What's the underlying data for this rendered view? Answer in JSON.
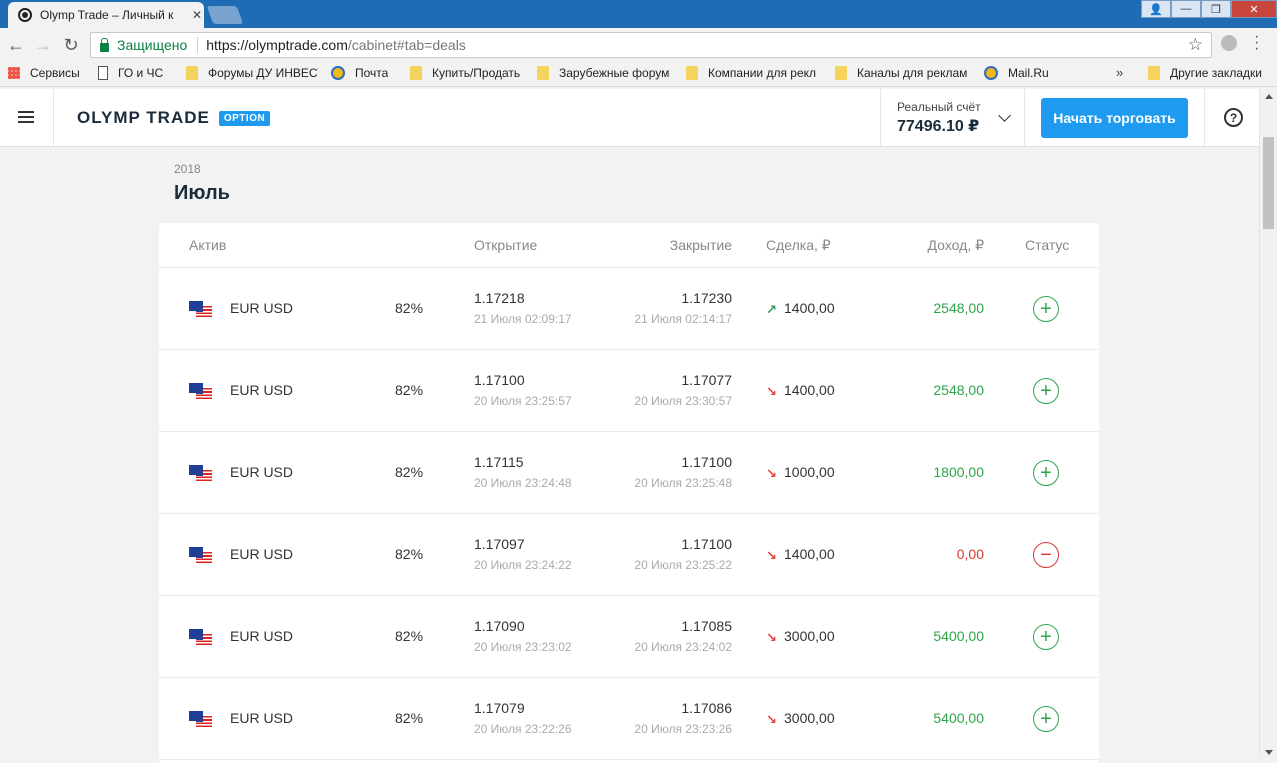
{
  "browser": {
    "tab_title": "Olymp Trade – Личный к",
    "tab_close": "✕",
    "window_buttons": [
      "👤",
      "—",
      "❐",
      "✕"
    ],
    "secure_label": "Защищено",
    "url_main": "https://olymptrade.com",
    "url_rest": "/cabinet#tab=deals",
    "bookmarks": [
      {
        "label": "Сервисы",
        "icon": "apps-icon"
      },
      {
        "label": "ГО и ЧС",
        "icon": "page-icon"
      },
      {
        "label": "Форумы ДУ ИНВЕСТ",
        "icon": "folder-icon"
      },
      {
        "label": "Почта",
        "icon": "mail-icon"
      },
      {
        "label": "Купить/Продать",
        "icon": "folder-icon"
      },
      {
        "label": "Зарубежные форум",
        "icon": "folder-icon"
      },
      {
        "label": "Компании для рекл",
        "icon": "folder-icon"
      },
      {
        "label": "Каналы для реклам",
        "icon": "folder-icon"
      },
      {
        "label": "Mail.Ru",
        "icon": "mail-icon"
      }
    ],
    "bookmarks_more": "»",
    "other_bookmarks": "Другие закладки"
  },
  "header": {
    "logo_text": "OLYMP TRADE",
    "logo_badge": "OPTION",
    "account_label": "Реальный счёт",
    "account_balance": "77496.10 ₽",
    "trade_button": "Начать торговать",
    "help": "?"
  },
  "deals": {
    "year": "2018",
    "month": "Июль",
    "columns": {
      "asset": "Актив",
      "open": "Открытие",
      "close": "Закрытие",
      "deal": "Сделка, ₽",
      "income": "Доход, ₽",
      "status": "Статус"
    },
    "rows": [
      {
        "asset": "EUR USD",
        "payout": "82%",
        "open_price": "1.17218",
        "open_time": "21 Июля 02:09:17",
        "close_price": "1.17230",
        "close_time": "21 Июля 02:14:17",
        "direction": "up",
        "arrow": "↗",
        "amount": "1400,00",
        "income": "2548,00",
        "result": "win",
        "status_symbol": "+"
      },
      {
        "asset": "EUR USD",
        "payout": "82%",
        "open_price": "1.17100",
        "open_time": "20 Июля 23:25:57",
        "close_price": "1.17077",
        "close_time": "20 Июля 23:30:57",
        "direction": "down",
        "arrow": "↘",
        "amount": "1400,00",
        "income": "2548,00",
        "result": "win",
        "status_symbol": "+"
      },
      {
        "asset": "EUR USD",
        "payout": "82%",
        "open_price": "1.17115",
        "open_time": "20 Июля 23:24:48",
        "close_price": "1.17100",
        "close_time": "20 Июля 23:25:48",
        "direction": "down",
        "arrow": "↘",
        "amount": "1000,00",
        "income": "1800,00",
        "result": "win",
        "status_symbol": "+"
      },
      {
        "asset": "EUR USD",
        "payout": "82%",
        "open_price": "1.17097",
        "open_time": "20 Июля 23:24:22",
        "close_price": "1.17100",
        "close_time": "20 Июля 23:25:22",
        "direction": "down",
        "arrow": "↘",
        "amount": "1400,00",
        "income": "0,00",
        "result": "loss",
        "status_symbol": "−"
      },
      {
        "asset": "EUR USD",
        "payout": "82%",
        "open_price": "1.17090",
        "open_time": "20 Июля 23:23:02",
        "close_price": "1.17085",
        "close_time": "20 Июля 23:24:02",
        "direction": "down",
        "arrow": "↘",
        "amount": "3000,00",
        "income": "5400,00",
        "result": "win",
        "status_symbol": "+"
      },
      {
        "asset": "EUR USD",
        "payout": "82%",
        "open_price": "1.17079",
        "open_time": "20 Июля 23:22:26",
        "close_price": "1.17086",
        "close_time": "20 Июля 23:23:26",
        "direction": "down",
        "arrow": "↘",
        "amount": "3000,00",
        "income": "5400,00",
        "result": "win",
        "status_symbol": "+"
      }
    ]
  }
}
